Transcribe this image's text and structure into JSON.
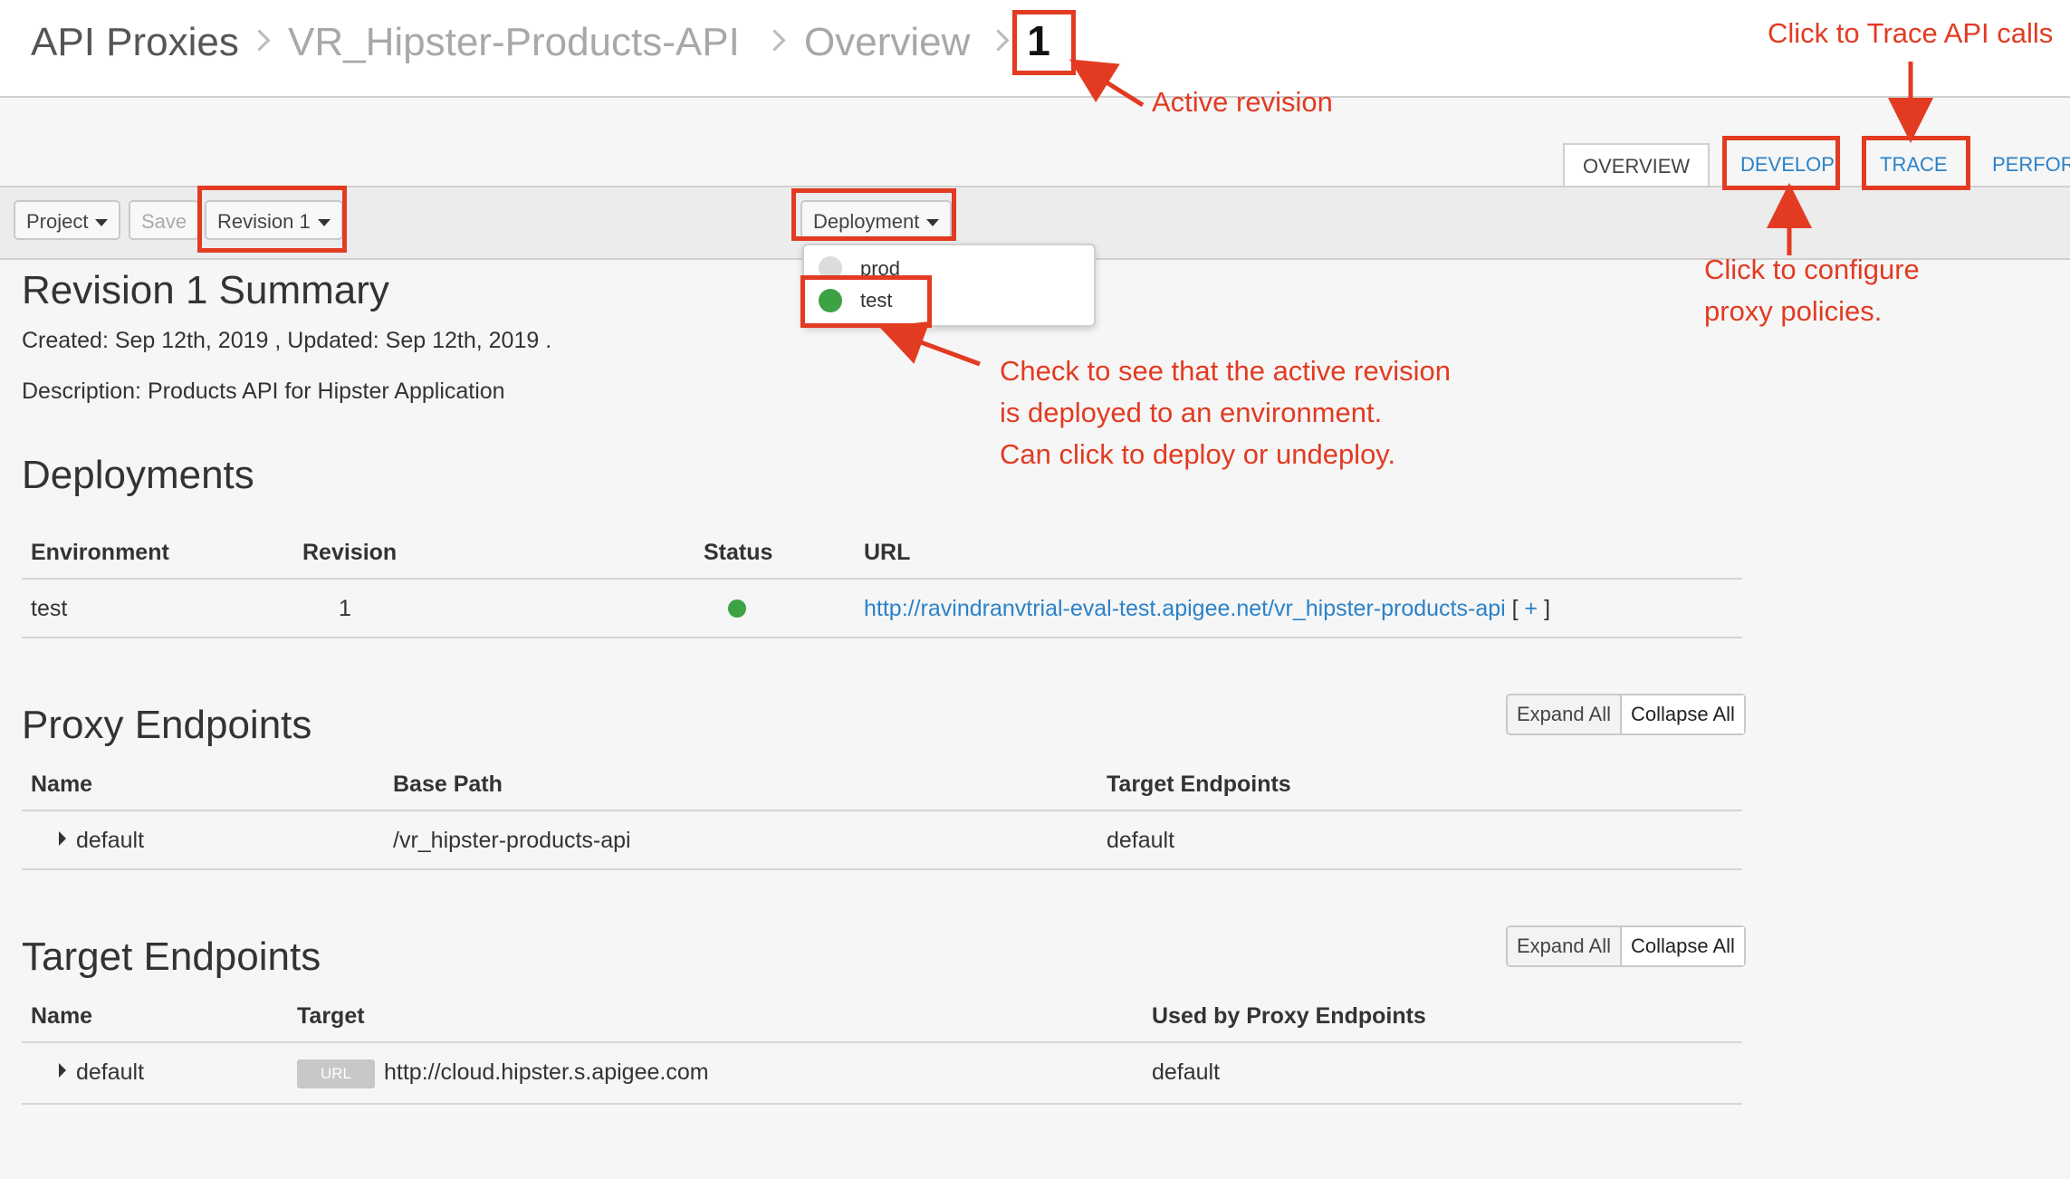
{
  "breadcrumb": [
    "API Proxies",
    "VR_Hipster-Products-API",
    "Overview"
  ],
  "active_revision_number": "1",
  "tabs": [
    "OVERVIEW",
    "DEVELOP",
    "TRACE",
    "PERFOR"
  ],
  "toolbar": {
    "project": "Project",
    "save": "Save",
    "revision": "Revision 1",
    "deployment": "Deployment"
  },
  "deployment_menu": [
    {
      "env": "prod",
      "status_color": "#dcdcdc"
    },
    {
      "env": "test",
      "status_color": "#3da244"
    }
  ],
  "annotations": {
    "active_revision": "Active revision",
    "trace": "Click to Trace API calls",
    "develop_1": "Click to configure",
    "develop_2": "proxy policies.",
    "deploy_1": "Check to see that the active revision",
    "deploy_2": "is deployed to an environment.",
    "deploy_3": "Can click to deploy or undeploy."
  },
  "summary": {
    "title": "Revision 1 Summary",
    "created": "Created: Sep 12th, 2019 , Updated: Sep 12th, 2019 .",
    "description": "Description: Products API for Hipster Application"
  },
  "deployments": {
    "title": "Deployments",
    "headers": [
      "Environment",
      "Revision",
      "Status",
      "URL"
    ],
    "rows": [
      {
        "env": "test",
        "revision": "1",
        "status_color": "#3da244",
        "url": "http://ravindranvtrial-eval-test.apigee.net/vr_hipster-products-api",
        "url_extra_open": "[",
        "url_extra_plus": "+",
        "url_extra_close": "]"
      }
    ]
  },
  "proxy_endpoints": {
    "title": "Proxy Endpoints",
    "expand_all": "Expand All",
    "collapse_all": "Collapse All",
    "headers": [
      "Name",
      "Base Path",
      "Target Endpoints"
    ],
    "rows": [
      {
        "name": "default",
        "base_path": "/vr_hipster-products-api",
        "target_endpoints": "default"
      }
    ]
  },
  "target_endpoints": {
    "title": "Target Endpoints",
    "expand_all": "Expand All",
    "collapse_all": "Collapse All",
    "headers": [
      "Name",
      "Target",
      "Used by Proxy Endpoints"
    ],
    "rows": [
      {
        "name": "default",
        "badge": "URL",
        "target": "http://cloud.hipster.s.apigee.com",
        "used_by": "default"
      }
    ]
  },
  "colors": {
    "annotation_red": "#e23b22",
    "link_blue": "#2a82c9"
  }
}
